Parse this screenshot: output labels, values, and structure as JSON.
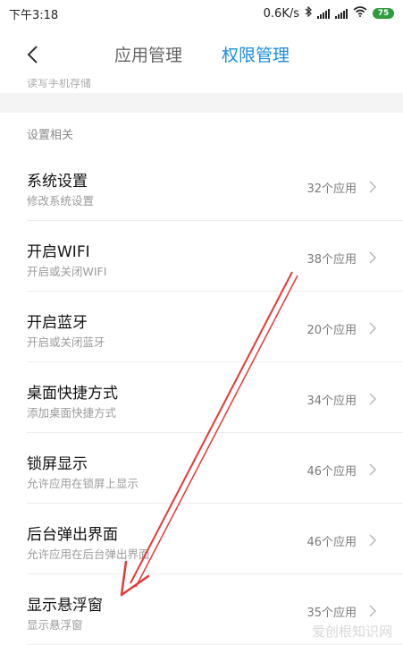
{
  "status": {
    "time": "下午3:18",
    "network_speed": "0.6K/s",
    "battery": "75"
  },
  "header": {
    "tab_app_manage": "应用管理",
    "tab_permission_manage": "权限管理",
    "active_color": "#1a8de0"
  },
  "partial_row": {
    "subtitle": "读写手机存储"
  },
  "section": {
    "title": "设置相关"
  },
  "rows": [
    {
      "title": "系统设置",
      "subtitle": "修改系统设置",
      "count": "32个应用"
    },
    {
      "title": "开启WIFI",
      "subtitle": "开启或关闭WIFI",
      "count": "38个应用"
    },
    {
      "title": "开启蓝牙",
      "subtitle": "开启或关闭蓝牙",
      "count": "20个应用"
    },
    {
      "title": "桌面快捷方式",
      "subtitle": "添加桌面快捷方式",
      "count": "34个应用"
    },
    {
      "title": "锁屏显示",
      "subtitle": "允许应用在锁屏上显示",
      "count": "46个应用"
    },
    {
      "title": "后台弹出界面",
      "subtitle": "允许应用在后台弹出界面",
      "count": "46个应用"
    },
    {
      "title": "显示悬浮窗",
      "subtitle": "显示悬浮窗",
      "count": "35个应用"
    }
  ],
  "annotation": {
    "arrow_color": "#e53935"
  },
  "watermark": "爱创根知识网"
}
